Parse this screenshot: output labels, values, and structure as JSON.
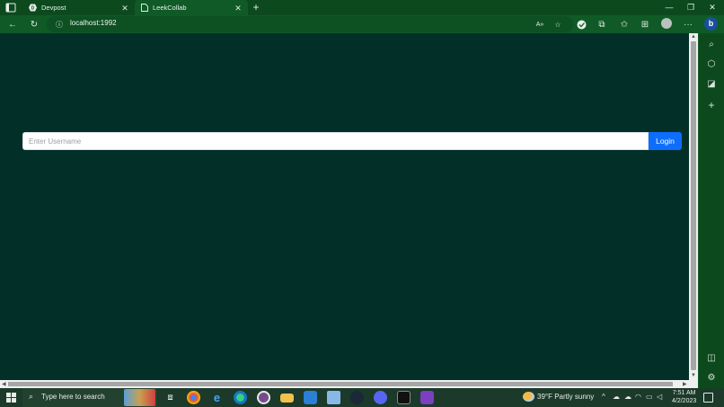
{
  "browser": {
    "tabs": [
      {
        "title": "Devpost",
        "favicon": "devpost-icon",
        "active": false
      },
      {
        "title": "LeekCollab",
        "favicon": "page-icon",
        "active": true
      }
    ],
    "address": "localhost:1992"
  },
  "page": {
    "username_placeholder": "Enter Username",
    "login_label": "Login"
  },
  "taskbar": {
    "search_placeholder": "Type here to search",
    "weather": "39°F  Partly sunny",
    "time": "7:51 AM",
    "date": "4/2/2023"
  },
  "colors": {
    "page_background": "#023029",
    "login_button": "#0d6efd",
    "browser_chrome": "#0c4a1e"
  }
}
